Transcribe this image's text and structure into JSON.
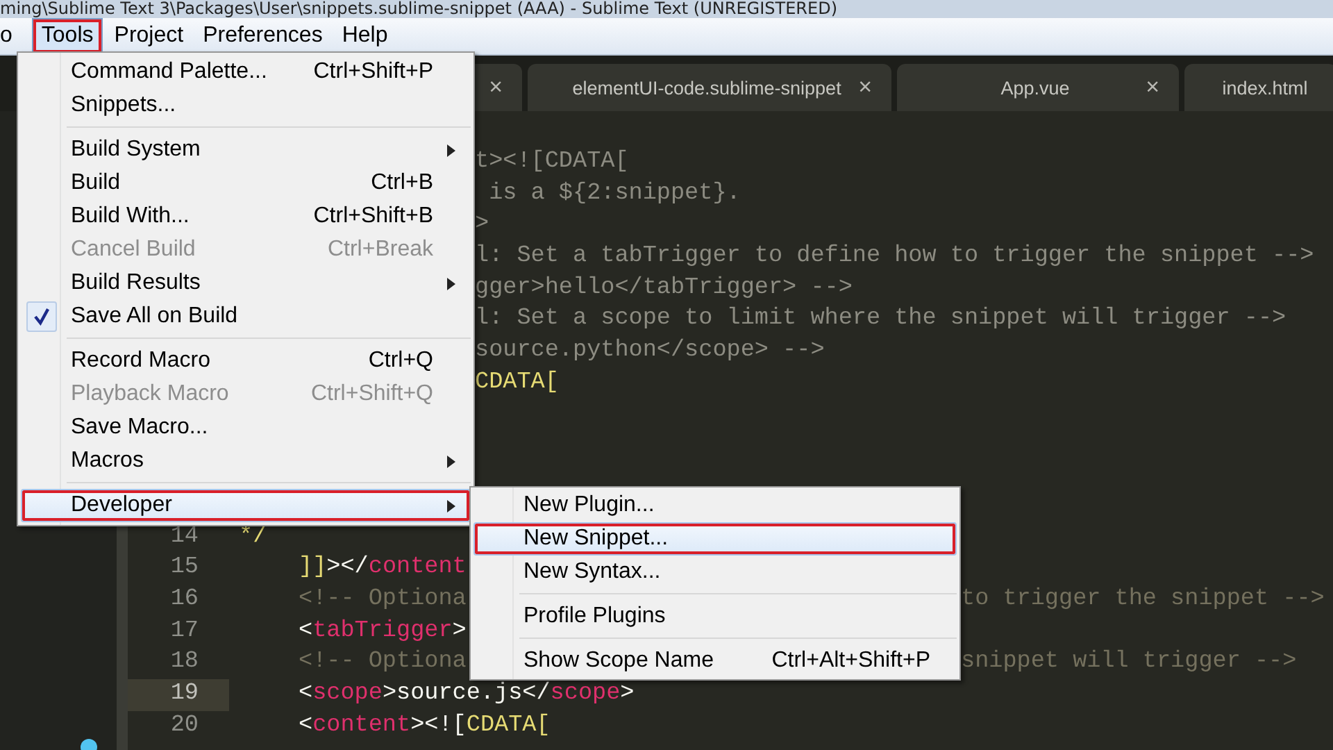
{
  "title_bar": {
    "title": "ming\\Sublime Text 3\\Packages\\User\\snippets.sublime-snippet (AAA) - Sublime Text (UNREGISTERED)"
  },
  "menu_bar": [
    {
      "label": "o",
      "selected": false,
      "annotated": false
    },
    {
      "label": "Tools",
      "selected": true,
      "annotated": true
    },
    {
      "label": "Project",
      "selected": false,
      "annotated": false
    },
    {
      "label": "Preferences",
      "selected": false,
      "annotated": false
    },
    {
      "label": "Help",
      "selected": false,
      "annotated": false
    }
  ],
  "tabs": [
    {
      "close": "×"
    },
    {
      "label": "elementUI-code.sublime-snippet",
      "close": "×"
    },
    {
      "label": "App.vue",
      "close": "×"
    },
    {
      "label": "index.html"
    }
  ],
  "editor": {
    "upper_lines": [
      {
        "segments": [
          {
            "kind": "middle",
            "tokens": [
              {
                "text": "t><![CDATA[",
                "kind": "dim"
              }
            ]
          }
        ]
      },
      {
        "segments": [
          {
            "kind": "middle",
            "tokens": [
              {
                "text": " is a ${2:snippet}.",
                "kind": "dim"
              }
            ]
          }
        ]
      },
      {
        "segments": [
          {
            "kind": "middle",
            "tokens": [
              {
                "text": ">",
                "kind": "dim"
              }
            ]
          }
        ]
      },
      {
        "segments": [
          {
            "kind": "middle",
            "tokens": [
              {
                "text": "l: Set a tabTrigger to define how to trigger the snippet -->",
                "kind": "dim"
              }
            ]
          }
        ]
      },
      {
        "segments": [
          {
            "kind": "middle",
            "tokens": [
              {
                "text": "gger>hello</tabTrigger> -->",
                "kind": "dim"
              }
            ]
          }
        ]
      },
      {
        "segments": [
          {
            "kind": "middle",
            "tokens": [
              {
                "text": "l: Set a scope to limit where the snippet will trigger -->",
                "kind": "dim"
              }
            ]
          }
        ]
      },
      {
        "segments": [
          {
            "kind": "middle",
            "tokens": [
              {
                "text": "source.python</scope> -->",
                "kind": "dim"
              }
            ]
          }
        ]
      },
      {
        "segments": [
          {
            "kind": "middle",
            "tokens": [
              {
                "text": "CDATA[",
                "kind": "string"
              }
            ]
          }
        ]
      }
    ],
    "lower_lines": [
      {
        "number": "14",
        "current": false,
        "segments": [
          {
            "kind": "start",
            "tokens": [
              {
                "text": "*/",
                "kind": "string"
              }
            ]
          }
        ]
      },
      {
        "number": "15",
        "current": false,
        "segments": [
          {
            "kind": "indented",
            "tokens": [
              {
                "text": "]]",
                "kind": "string"
              },
              {
                "text": "></",
                "kind": "plain"
              },
              {
                "text": "content",
                "kind": "tag"
              }
            ]
          }
        ]
      },
      {
        "number": "16",
        "current": false,
        "segments": [
          {
            "kind": "indented",
            "tokens": [
              {
                "text": "<!-- Optiona",
                "kind": "comment"
              }
            ]
          },
          {
            "kind": "right",
            "tokens": [
              {
                "text": "to trigger the snippet -->",
                "kind": "comment"
              }
            ]
          }
        ]
      },
      {
        "number": "17",
        "current": false,
        "segments": [
          {
            "kind": "indented",
            "tokens": [
              {
                "text": "<",
                "kind": "plain"
              },
              {
                "text": "tabTrigger",
                "kind": "tag"
              },
              {
                "text": ">",
                "kind": "plain"
              }
            ]
          }
        ]
      },
      {
        "number": "18",
        "current": false,
        "segments": [
          {
            "kind": "indented",
            "tokens": [
              {
                "text": "<!-- Optiona",
                "kind": "comment"
              }
            ]
          },
          {
            "kind": "right",
            "tokens": [
              {
                "text": "snippet will trigger -->",
                "kind": "comment"
              }
            ]
          }
        ]
      },
      {
        "number": "19",
        "current": true,
        "segments": [
          {
            "kind": "indented",
            "tokens": [
              {
                "text": "<",
                "kind": "plain"
              },
              {
                "text": "scope",
                "kind": "tag"
              },
              {
                "text": ">source.js</",
                "kind": "plain"
              },
              {
                "text": "scope",
                "kind": "tag"
              },
              {
                "text": ">",
                "kind": "plain"
              }
            ]
          }
        ]
      },
      {
        "number": "20",
        "current": false,
        "segments": [
          {
            "kind": "indented",
            "tokens": [
              {
                "text": "<",
                "kind": "plain"
              },
              {
                "text": "content",
                "kind": "tag"
              },
              {
                "text": "><![",
                "kind": "plain"
              },
              {
                "text": "CDATA[",
                "kind": "string"
              }
            ]
          }
        ]
      }
    ]
  },
  "tools_menu": {
    "items": [
      {
        "kind": "item",
        "label": "Command Palette...",
        "shortcut": "Ctrl+Shift+P",
        "submenu": false,
        "disabled": false,
        "checked": false,
        "selected": false,
        "annotated": false
      },
      {
        "kind": "item",
        "label": "Snippets...",
        "submenu": false,
        "disabled": false,
        "checked": false,
        "selected": false,
        "annotated": false
      },
      {
        "kind": "separator"
      },
      {
        "kind": "item",
        "label": "Build System",
        "submenu": true,
        "disabled": false,
        "checked": false,
        "selected": false,
        "annotated": false
      },
      {
        "kind": "item",
        "label": "Build",
        "shortcut": "Ctrl+B",
        "submenu": false,
        "disabled": false,
        "checked": false,
        "selected": false,
        "annotated": false
      },
      {
        "kind": "item",
        "label": "Build With...",
        "shortcut": "Ctrl+Shift+B",
        "submenu": false,
        "disabled": false,
        "checked": false,
        "selected": false,
        "annotated": false
      },
      {
        "kind": "item",
        "label": "Cancel Build",
        "shortcut": "Ctrl+Break",
        "submenu": false,
        "disabled": true,
        "checked": false,
        "selected": false,
        "annotated": false
      },
      {
        "kind": "item",
        "label": "Build Results",
        "submenu": true,
        "disabled": false,
        "checked": false,
        "selected": false,
        "annotated": false
      },
      {
        "kind": "item",
        "label": "Save All on Build",
        "submenu": false,
        "disabled": false,
        "checked": true,
        "selected": false,
        "annotated": false
      },
      {
        "kind": "separator"
      },
      {
        "kind": "item",
        "label": "Record Macro",
        "shortcut": "Ctrl+Q",
        "submenu": false,
        "disabled": false,
        "checked": false,
        "selected": false,
        "annotated": false
      },
      {
        "kind": "item",
        "label": "Playback Macro",
        "shortcut": "Ctrl+Shift+Q",
        "submenu": false,
        "disabled": true,
        "checked": false,
        "selected": false,
        "annotated": false
      },
      {
        "kind": "item",
        "label": "Save Macro...",
        "submenu": false,
        "disabled": false,
        "checked": false,
        "selected": false,
        "annotated": false
      },
      {
        "kind": "item",
        "label": "Macros",
        "submenu": true,
        "disabled": false,
        "checked": false,
        "selected": false,
        "annotated": false
      },
      {
        "kind": "separator"
      },
      {
        "kind": "item",
        "label": "Developer",
        "submenu": true,
        "disabled": false,
        "checked": false,
        "selected": true,
        "annotated": true
      }
    ]
  },
  "developer_submenu": {
    "items": [
      {
        "kind": "item",
        "label": "New Plugin...",
        "submenu": false,
        "disabled": false,
        "checked": false,
        "selected": false,
        "annotated": false
      },
      {
        "kind": "item",
        "label": "New Snippet...",
        "submenu": false,
        "disabled": false,
        "checked": false,
        "selected": true,
        "annotated": true
      },
      {
        "kind": "item",
        "label": "New Syntax...",
        "submenu": false,
        "disabled": false,
        "checked": false,
        "selected": false,
        "annotated": false
      },
      {
        "kind": "separator"
      },
      {
        "kind": "item",
        "label": "Profile Plugins",
        "submenu": false,
        "disabled": false,
        "checked": false,
        "selected": false,
        "annotated": false
      },
      {
        "kind": "separator"
      },
      {
        "kind": "item",
        "label": "Show Scope Name",
        "shortcut": "Ctrl+Alt+Shift+P",
        "submenu": false,
        "disabled": false,
        "checked": false,
        "selected": false,
        "annotated": false
      }
    ]
  }
}
